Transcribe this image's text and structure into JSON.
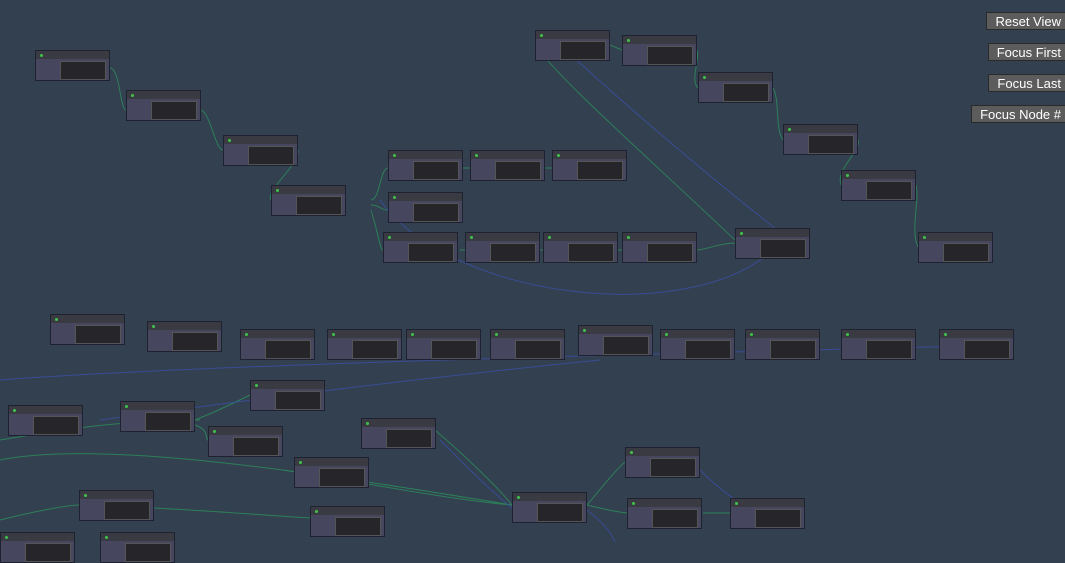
{
  "buttons": {
    "reset": "Reset View",
    "focus_first": "Focus First",
    "focus_last": "Focus Last",
    "focus_node": "Focus Node #"
  },
  "colors": {
    "background": "#334050",
    "edge_green": "#2c8a5a",
    "edge_blue": "#3a4fa0",
    "node": "#46465e"
  }
}
